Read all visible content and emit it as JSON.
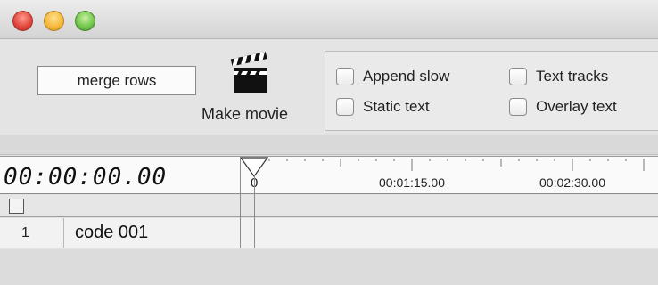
{
  "toolbar": {
    "merge_label": "merge rows",
    "make_movie_label": "Make movie",
    "options": [
      {
        "label": "Append slow",
        "checked": false
      },
      {
        "label": "Text tracks",
        "checked": false
      },
      {
        "label": "Static text",
        "checked": false
      },
      {
        "label": "Overlay text",
        "checked": false
      }
    ]
  },
  "timeline": {
    "timecode": "00:00:00.00",
    "playhead_label": "0",
    "ticks": [
      "00:01:15.00",
      "00:02:30.00"
    ]
  },
  "rows": [
    {
      "number": "1",
      "label": "code 001"
    }
  ],
  "colors": {
    "close": "#e0443a",
    "minimize": "#f4b73a",
    "maximize": "#6fc44a"
  }
}
